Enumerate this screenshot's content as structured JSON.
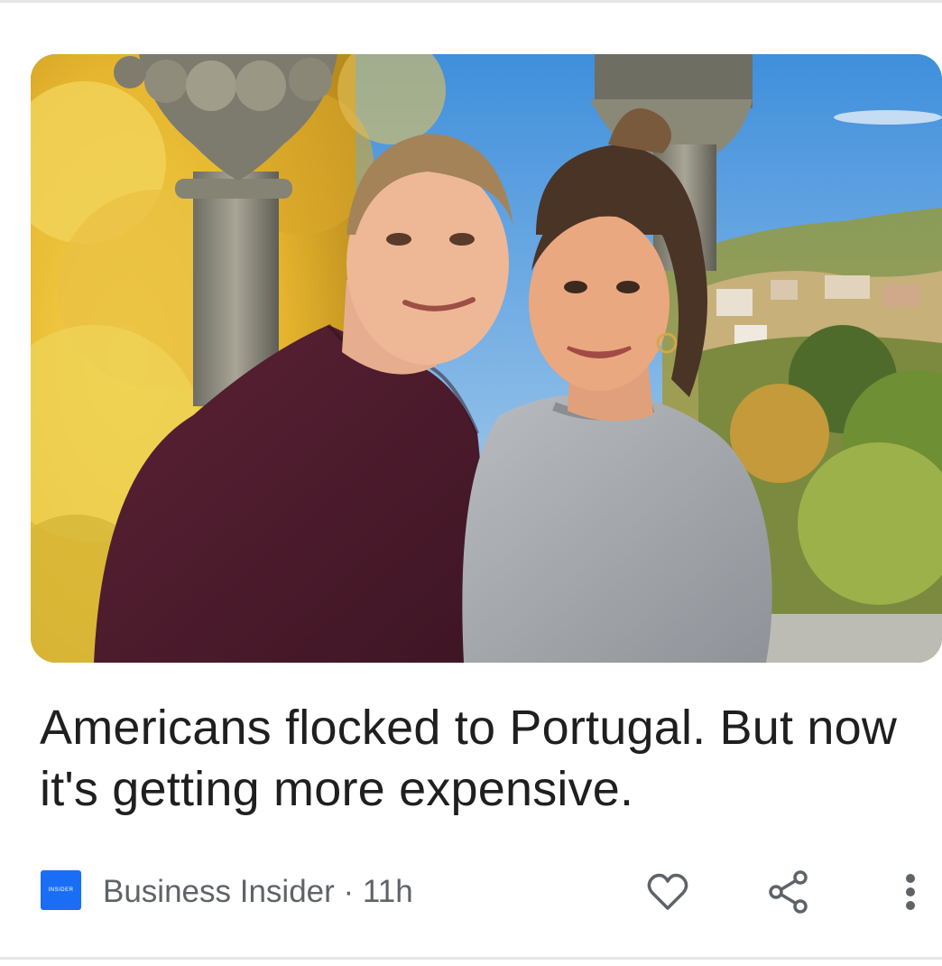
{
  "article": {
    "headline": "Americans flocked to Portugal. But now it's getting more expensive.",
    "image_alt": "Couple smiling in front of a stone column with autumn trees and a hillside town behind them",
    "source": {
      "logo_text": "INSIDER",
      "name": "Business Insider",
      "separator": " · ",
      "age": "11h"
    }
  },
  "actions": {
    "like_icon": "heart-outline-icon",
    "share_icon": "share-icon",
    "more_icon": "more-vertical-icon"
  },
  "colors": {
    "accent_logo": "#1a6ef5",
    "headline_text": "#1f1f1f",
    "meta_text": "#5f6368",
    "icon": "#5f6368"
  }
}
